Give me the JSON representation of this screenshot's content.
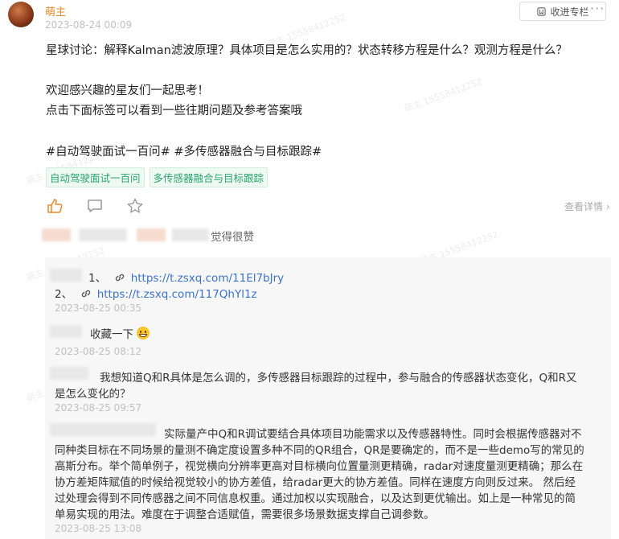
{
  "post": {
    "author": "萌主",
    "time": "2023-08-24 00:09",
    "collect_label": "收进专栏",
    "more_label": "···",
    "lines": [
      "星球讨论：解释Kalman滤波原理？具体项目是怎么实用的？状态转移方程是什么？观测方程是什么？",
      "欢迎感兴趣的星友们一起思考！",
      "点击下面标签可以看到一些往期问题及参考答案哦",
      "#自动驾驶面试一百问# #多传感器融合与目标跟踪#"
    ],
    "tags": [
      "自动驾驶面试一百问",
      "多传感器融合与目标跟踪"
    ],
    "details_label": "查看详情",
    "likes_suffix": "觉得很赞"
  },
  "comments": [
    {
      "lines": [
        "1、 https://t.zsxq.com/11El7bJry",
        "2、 https://t.zsxq.com/117QhYl1z"
      ],
      "link1_prefix": "1、",
      "link1": "https://t.zsxq.com/11El7bJry",
      "link2_prefix": "2、",
      "link2": "https://t.zsxq.com/117QhYl1z",
      "time": "2023-08-25 00:35"
    },
    {
      "text": "收藏一下",
      "time": "2023-08-25 08:12"
    },
    {
      "lines": [
        "我想知道Q和R具体是怎么调的，多传感器目标跟踪的过程中，参与融合的传感器状态变化，Q和R又",
        "是怎么变化的？"
      ],
      "time": "2023-08-25 09:57"
    },
    {
      "lines": [
        "实际量产中Q和R调试要结合具体项目功能需求以及传感器特性。同时会根据传感器对不",
        "同种类目标在不同场景的量测不确定度设置多种不同的QR组合，QR是要确定的，而不是一些demo写的常见的",
        "高斯分布。举个简单例子，视觉横向分辨率更高对目标横向位置量测更精确，radar对速度量测更精确；那么在",
        "协方差矩阵赋值的时候给视觉较小的协方差值，给radar更大的协方差值。同样在速度方向则反过来。 然后经",
        "过处理会得到不同传感器之间不同信息权重。通过加权以实现融合，以及达到更优输出。如上是一种常见的简",
        "单易实现的用法。难度在于调整合适赋值，需要很多场景数据支撑自己调参数。"
      ],
      "time": "2023-08-25 13:08"
    }
  ],
  "watermark": "萌主 15558412252",
  "colors": {
    "accent": "#e88a2a",
    "tag_green": "#2aa56c",
    "link": "#3b73c9"
  },
  "icons": [
    "bookmark-icon",
    "like-icon",
    "comment-icon",
    "star-icon",
    "link-icon",
    "chevron-right-icon"
  ]
}
